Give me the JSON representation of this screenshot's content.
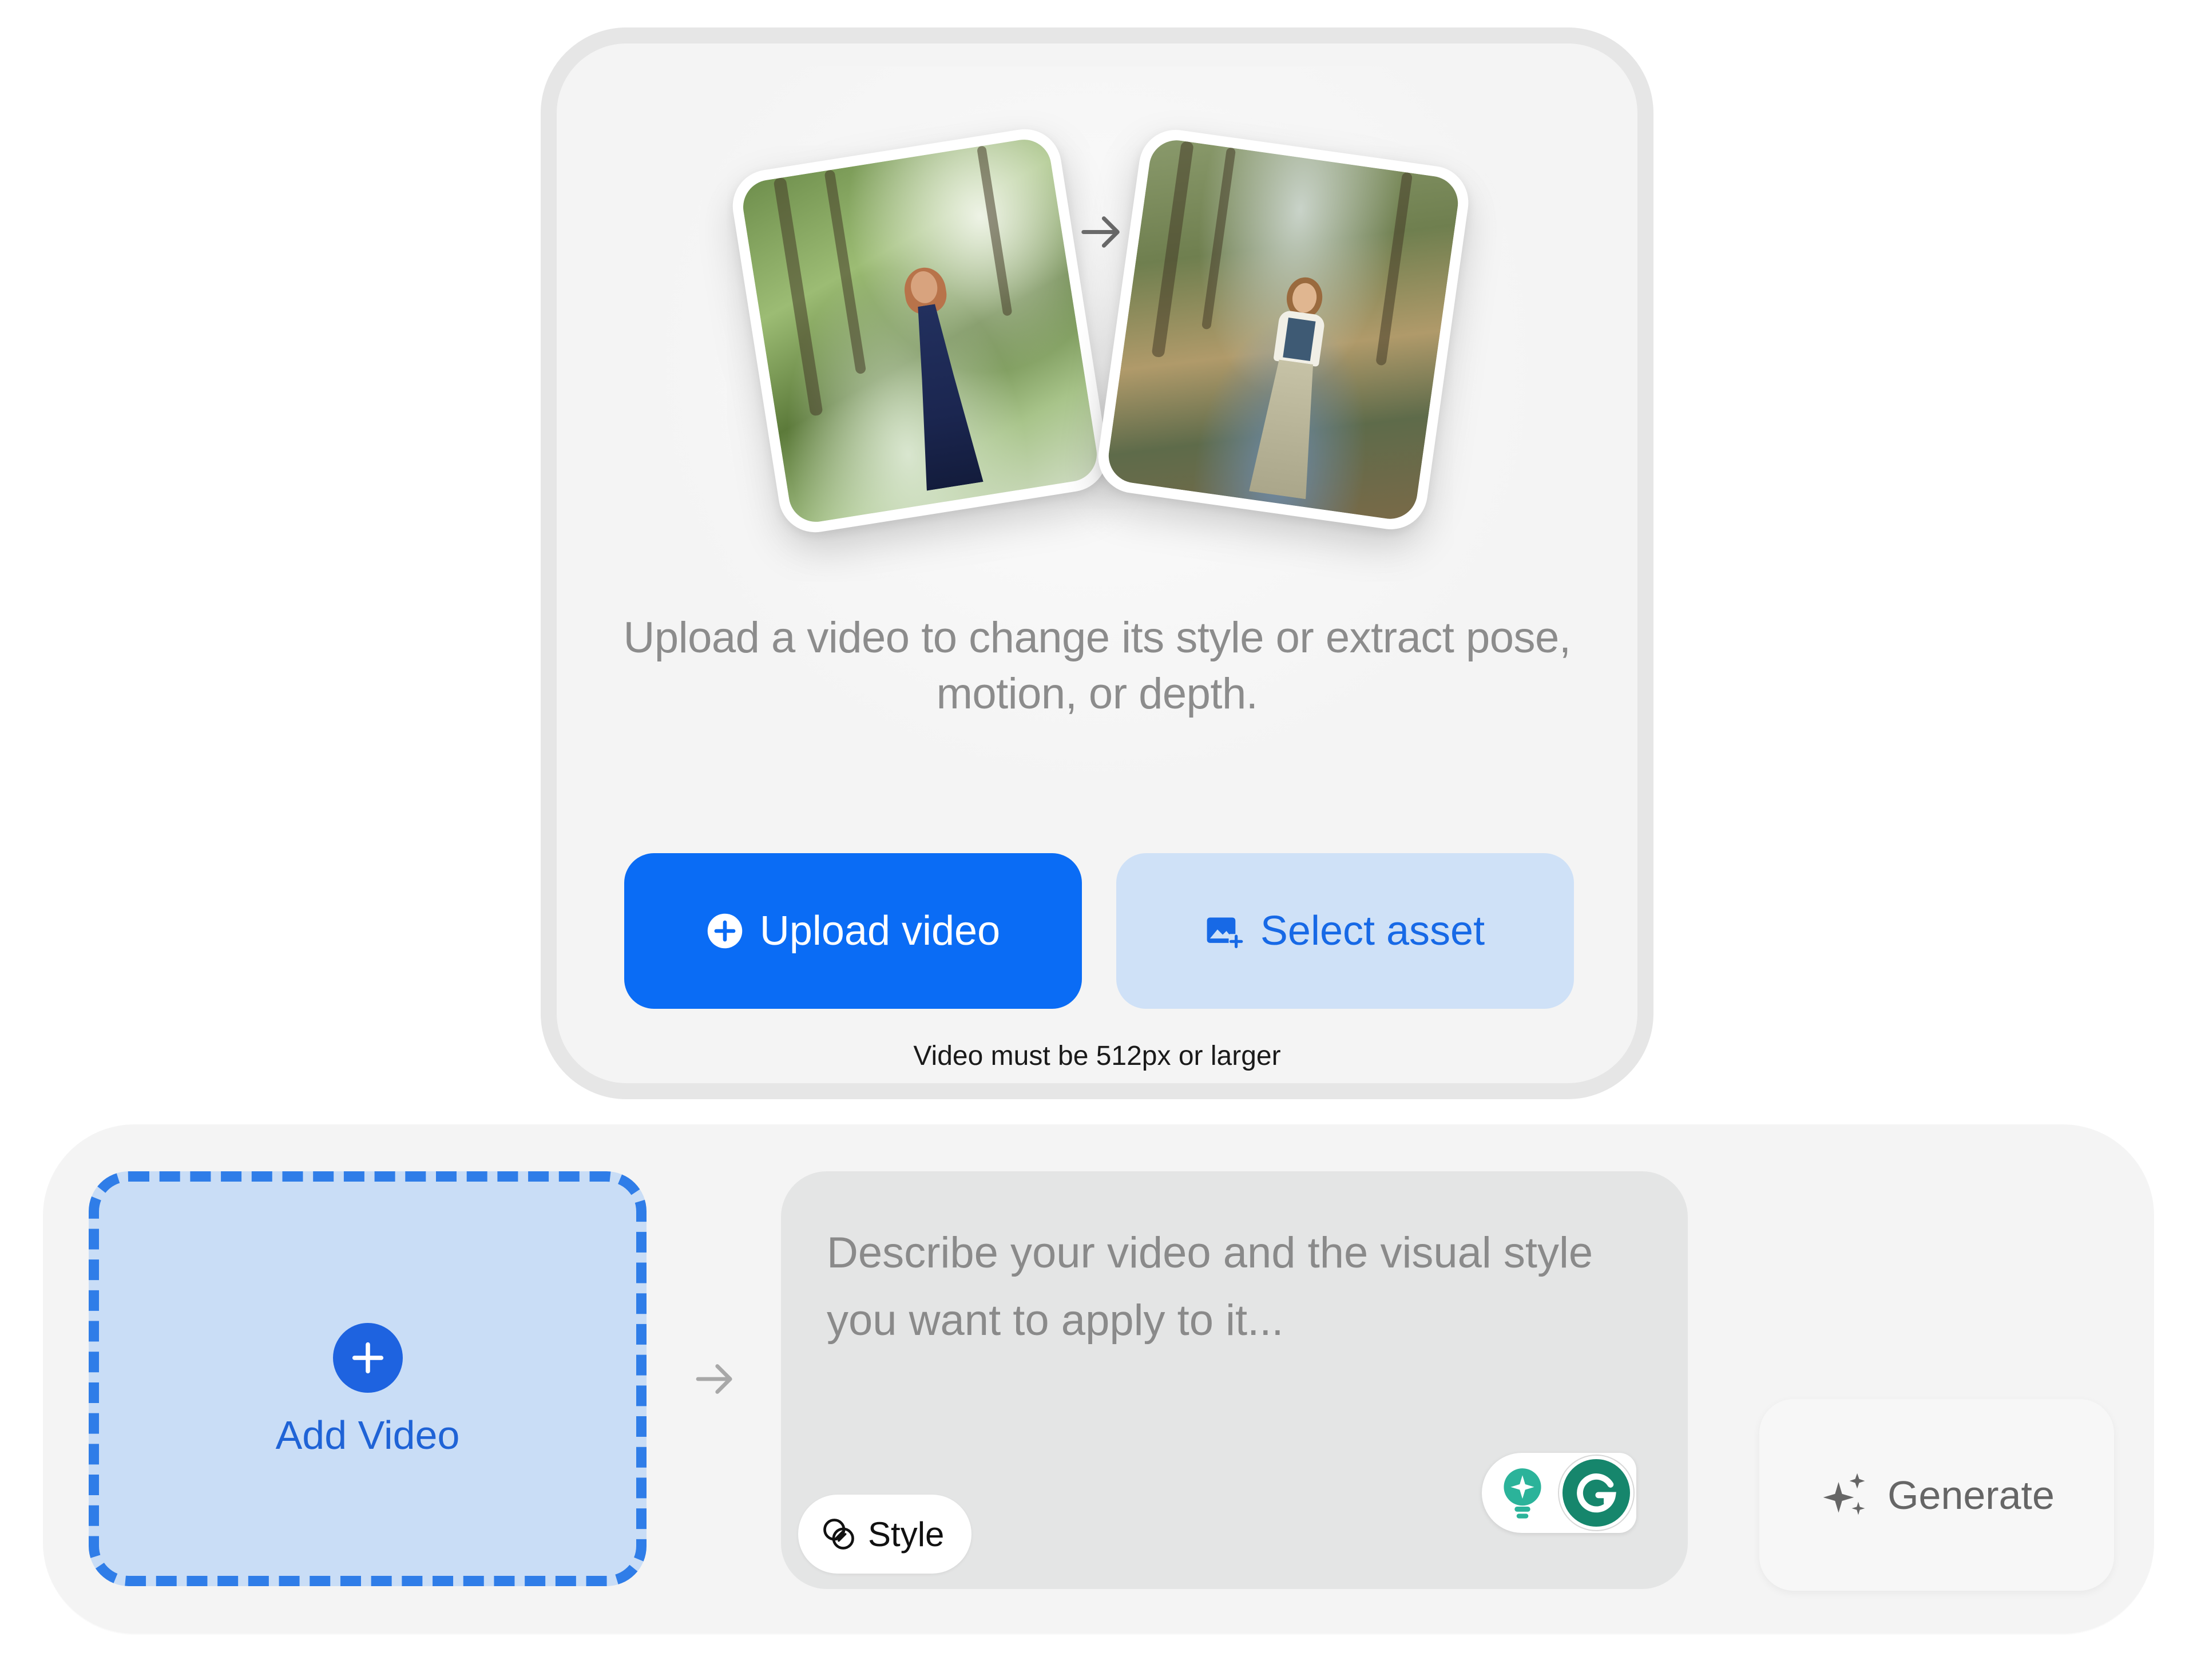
{
  "upload_panel": {
    "description": "Upload a video to change its style or extract pose, motion, or depth.",
    "upload_button_label": "Upload video",
    "select_asset_label": "Select asset",
    "size_requirement": "Video must be 512px or larger",
    "icons": {
      "example_before": "forest-woman-photo",
      "example_after": "forest-woman-painting",
      "transform_arrow": "arrow-right-icon",
      "upload": "plus-circle-icon",
      "asset": "image-add-icon"
    }
  },
  "composer": {
    "add_video_label": "Add Video",
    "prompt_placeholder": "Describe your video and the visual style you want to apply to it...",
    "prompt_value": "",
    "style_chip_label": "Style",
    "generate_label": "Generate",
    "icons": {
      "add": "plus-circle-icon",
      "flow_arrow": "arrow-right-icon",
      "style": "overlapping-circles-icon",
      "extension_hint": "lightbulb-icon",
      "extension_grammar": "grammarly-g-icon",
      "generate": "sparkles-icon"
    }
  },
  "colors": {
    "primary_blue": "#0a6cf5",
    "secondary_blue_bg": "#cfe1f7",
    "dashed_border": "#2f7de8",
    "grammar_green": "#16866c",
    "hint_teal": "#2bb39a"
  }
}
